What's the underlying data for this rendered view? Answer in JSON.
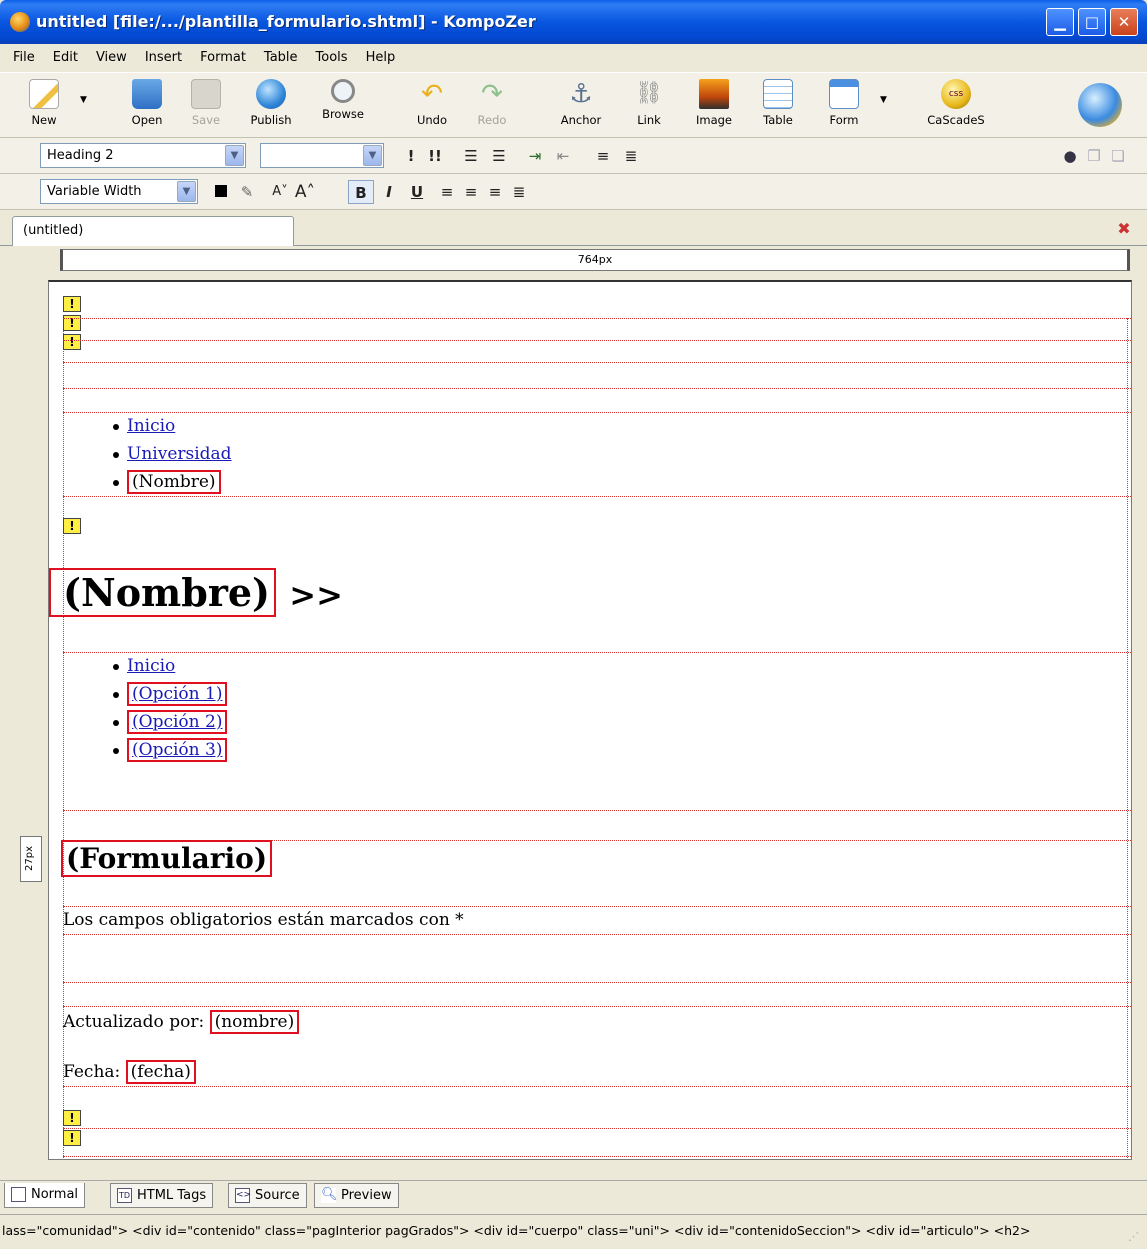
{
  "window": {
    "title": "untitled [file:/.../plantilla_formulario.shtml] - KompoZer"
  },
  "menu": [
    "File",
    "Edit",
    "View",
    "Insert",
    "Format",
    "Table",
    "Tools",
    "Help"
  ],
  "toolbar": {
    "new": "New",
    "open": "Open",
    "save": "Save",
    "publish": "Publish",
    "browse": "Browse",
    "undo": "Undo",
    "redo": "Redo",
    "anchor": "Anchor",
    "link": "Link",
    "image": "Image",
    "table": "Table",
    "form": "Form",
    "cascades": "CaScadeS"
  },
  "format": {
    "paragraph_style": "Heading 2",
    "class_value": "",
    "font": "Variable Width"
  },
  "tabs": {
    "document": "(untitled)"
  },
  "ruler": {
    "width_label": "764px",
    "height_label": "27px"
  },
  "content": {
    "nav1": [
      "Inicio",
      "Universidad",
      "(Nombre)"
    ],
    "heading_name": "(Nombre)",
    "heading_suffix": ">>",
    "nav2": [
      "Inicio",
      "(Opción 1)",
      "(Opción 2)",
      "(Opción 3)"
    ],
    "form_heading": "(Formulario)",
    "required_note": "Los campos obligatorios están marcados con *",
    "updated_label": "Actualizado por:",
    "updated_value": "(nombre)",
    "date_label": "Fecha:",
    "date_value": "(fecha)"
  },
  "mode_tabs": {
    "normal": "Normal",
    "html_tags": "HTML Tags",
    "source": "Source",
    "preview": "Preview"
  },
  "status": {
    "path": "lass=\"comunidad\"> <div id=\"contenido\" class=\"pagInterior pagGrados\"> <div id=\"cuerpo\" class=\"uni\"> <div id=\"contenidoSeccion\"> <div id=\"articulo\"> <h2>"
  },
  "colors": {
    "titlebar": "#0a5ee8",
    "marker": "#e01020",
    "link": "#1a1ab8"
  }
}
